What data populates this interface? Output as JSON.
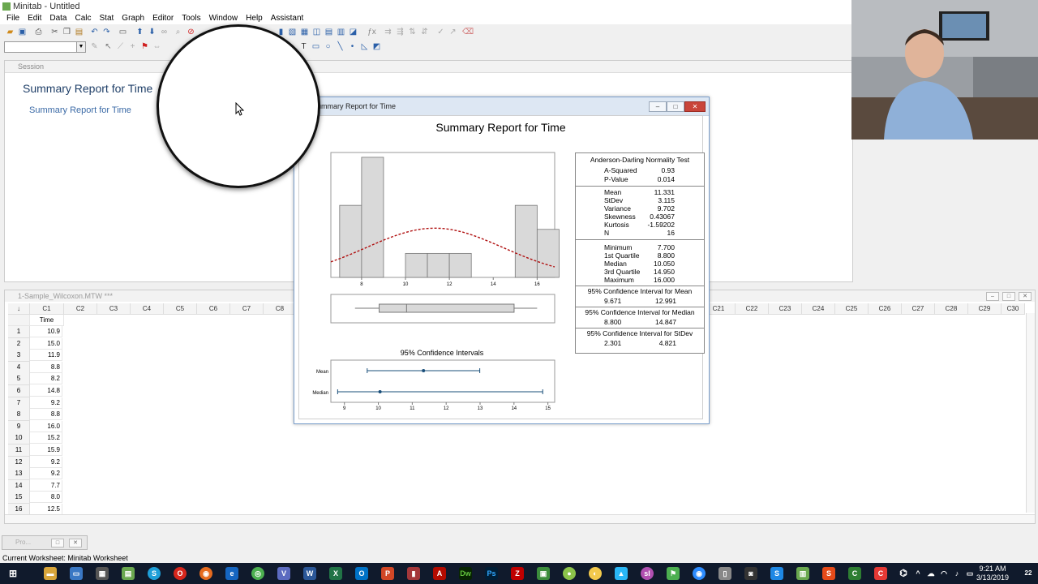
{
  "window": {
    "title": "Minitab - Untitled"
  },
  "menu": [
    "File",
    "Edit",
    "Data",
    "Calc",
    "Stat",
    "Graph",
    "Editor",
    "Tools",
    "Window",
    "Help",
    "Assistant"
  ],
  "session": {
    "header": "Session",
    "title": "Summary Report for Time",
    "link": "Summary Report for Time"
  },
  "worksheet": {
    "title": "1-Sample_Wilcoxon.MTW ***",
    "columns_left": [
      "C1",
      "C2",
      "C3",
      "C4",
      "C5",
      "C6",
      "C7",
      "C8"
    ],
    "columns_right": [
      "C21",
      "C22",
      "C23",
      "C24",
      "C25",
      "C26",
      "C27",
      "C28",
      "C29",
      "C30"
    ],
    "c1_name": "Time",
    "rows": [
      {
        "n": "1",
        "v": "10.9"
      },
      {
        "n": "2",
        "v": "15.0"
      },
      {
        "n": "3",
        "v": "11.9"
      },
      {
        "n": "4",
        "v": "8.8"
      },
      {
        "n": "5",
        "v": "8.2"
      },
      {
        "n": "6",
        "v": "14.8"
      },
      {
        "n": "7",
        "v": "9.2"
      },
      {
        "n": "8",
        "v": "8.8"
      },
      {
        "n": "9",
        "v": "16.0"
      },
      {
        "n": "10",
        "v": "15.2"
      },
      {
        "n": "11",
        "v": "15.9"
      },
      {
        "n": "12",
        "v": "9.2"
      },
      {
        "n": "13",
        "v": "9.2"
      },
      {
        "n": "14",
        "v": "7.7"
      },
      {
        "n": "15",
        "v": "8.0"
      },
      {
        "n": "16",
        "v": "12.5"
      }
    ]
  },
  "dialog": {
    "title": "Summary Report for Time",
    "report_title": "Summary Report for Time",
    "histogram": {
      "x_ticks": [
        "8",
        "10",
        "12",
        "14",
        "16"
      ],
      "bins": [
        {
          "x0": 7,
          "x1": 8,
          "count": 3
        },
        {
          "x0": 8,
          "x1": 9,
          "count": 5
        },
        {
          "x0": 9,
          "x1": 10,
          "count": 0
        },
        {
          "x0": 10,
          "x1": 11,
          "count": 1
        },
        {
          "x0": 11,
          "x1": 12,
          "count": 1
        },
        {
          "x0": 12,
          "x1": 13,
          "count": 1
        },
        {
          "x0": 13,
          "x1": 14,
          "count": 0
        },
        {
          "x0": 14,
          "x1": 15,
          "count": 0
        },
        {
          "x0": 15,
          "x1": 16,
          "count": 3
        },
        {
          "x0": 16,
          "x1": 17,
          "count": 2
        }
      ],
      "xlim": [
        6.6,
        16.8
      ],
      "ymax": 5.2,
      "normal_mean": 11.331,
      "normal_sd": 3.115,
      "curve_color": "#b01010"
    },
    "boxplot": {
      "whisker_low": 7.7,
      "q1": 8.8,
      "median": 10.05,
      "q3": 14.95,
      "whisker_high": 16.0
    },
    "ci": {
      "title": "95% Confidence Intervals",
      "labels": [
        "Mean",
        "Median"
      ],
      "x_ticks": [
        "9",
        "10",
        "11",
        "12",
        "13",
        "14",
        "15"
      ],
      "xlim": [
        8.6,
        15.2
      ],
      "mean": {
        "low": 9.671,
        "point": 11.331,
        "high": 12.991
      },
      "median": {
        "low": 8.8,
        "point": 10.05,
        "high": 14.847
      },
      "color": "#1a4f7a"
    },
    "stats": {
      "ad_title": "Anderson-Darling Normality Test",
      "ad": [
        {
          "k": "A-Squared",
          "v": "0.93"
        },
        {
          "k": "P-Value",
          "v": "0.014"
        }
      ],
      "desc": [
        {
          "k": "Mean",
          "v": "11.331"
        },
        {
          "k": "StDev",
          "v": "3.115"
        },
        {
          "k": "Variance",
          "v": "9.702"
        },
        {
          "k": "Skewness",
          "v": "0.43067"
        },
        {
          "k": "Kurtosis",
          "v": "-1.59202"
        },
        {
          "k": "N",
          "v": "16"
        }
      ],
      "quart": [
        {
          "k": "Minimum",
          "v": "7.700"
        },
        {
          "k": "1st Quartile",
          "v": "8.800"
        },
        {
          "k": "Median",
          "v": "10.050"
        },
        {
          "k": "3rd Quartile",
          "v": "14.950"
        },
        {
          "k": "Maximum",
          "v": "16.000"
        }
      ],
      "ci_mean_title": "95% Confidence Interval for Mean",
      "ci_mean": [
        "9.671",
        "12.991"
      ],
      "ci_median_title": "95% Confidence Interval for Median",
      "ci_median": [
        "8.800",
        "14.847"
      ],
      "ci_stdev_title": "95% Confidence Interval for StDev",
      "ci_stdev": [
        "2.301",
        "4.821"
      ]
    }
  },
  "minimized": {
    "label": "Pro..."
  },
  "status": {
    "text": "Current Worksheet: Minitab Worksheet"
  },
  "taskbar": {
    "time": "9:21 AM",
    "date": "3/13/2019",
    "badge": "22"
  }
}
